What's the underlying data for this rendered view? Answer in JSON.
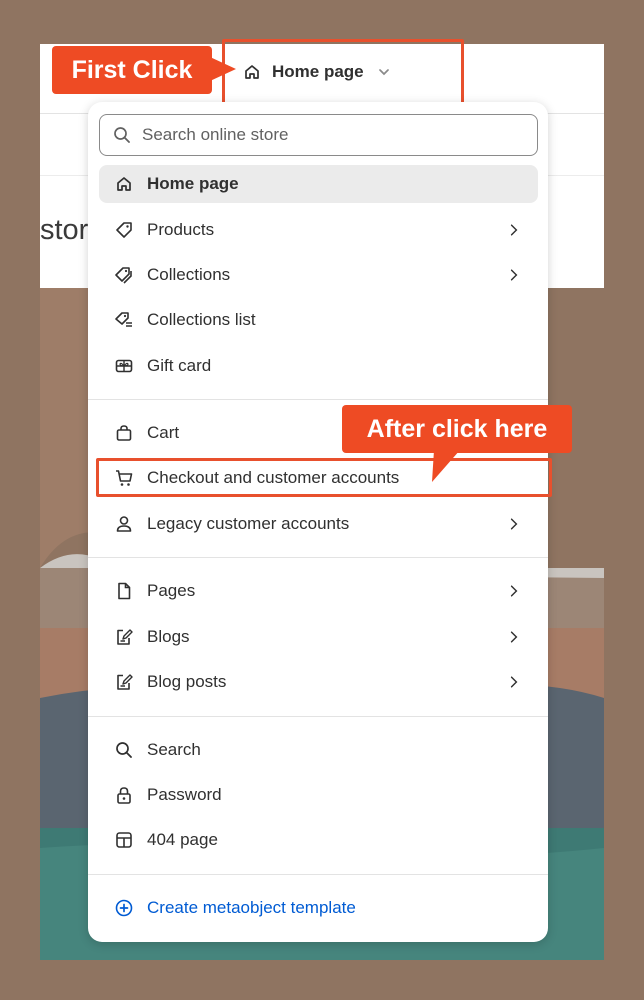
{
  "annotations": {
    "first_click": "First Click",
    "after_click": "After click here",
    "accent_color": "#ee4b24"
  },
  "header": {
    "page_selector_label": "Home page",
    "page_selector_icon": "home-icon",
    "partial_store_title": "stor"
  },
  "menu": {
    "search_placeholder": "Search online store",
    "items": [
      {
        "label": "Home page",
        "icon": "home-icon",
        "active": true,
        "has_submenu": false
      },
      {
        "label": "Products",
        "icon": "tag-icon",
        "has_submenu": true
      },
      {
        "label": "Collections",
        "icon": "tags-icon",
        "has_submenu": true
      },
      {
        "label": "Collections list",
        "icon": "tag-list-icon",
        "has_submenu": false
      },
      {
        "label": "Gift card",
        "icon": "gift-card-icon",
        "has_submenu": false
      },
      {
        "label": "Cart",
        "icon": "bag-icon",
        "has_submenu": false
      },
      {
        "label": "Checkout and customer accounts",
        "icon": "cart-icon",
        "has_submenu": false,
        "highlighted": true
      },
      {
        "label": "Legacy customer accounts",
        "icon": "person-icon",
        "has_submenu": true
      },
      {
        "label": "Pages",
        "icon": "page-icon",
        "has_submenu": true
      },
      {
        "label": "Blogs",
        "icon": "blog-icon",
        "has_submenu": true
      },
      {
        "label": "Blog posts",
        "icon": "blog-post-icon",
        "has_submenu": true
      },
      {
        "label": "Search",
        "icon": "search-icon",
        "has_submenu": false
      },
      {
        "label": "Password",
        "icon": "lock-icon",
        "has_submenu": false
      },
      {
        "label": "404 page",
        "icon": "layout-icon",
        "has_submenu": false
      }
    ],
    "create_label": "Create metaobject template",
    "link_color": "#005bd3"
  }
}
